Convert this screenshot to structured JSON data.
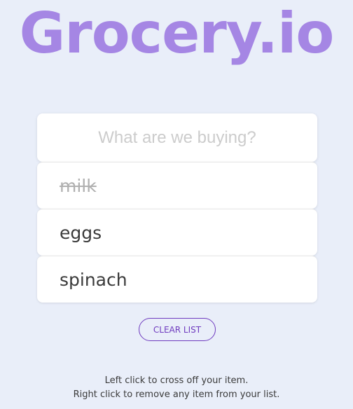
{
  "header": {
    "logo_text": "Grocery.io"
  },
  "input": {
    "placeholder": "What are we buying?",
    "value": ""
  },
  "items": [
    {
      "label": "milk",
      "crossed": true
    },
    {
      "label": "eggs",
      "crossed": false
    },
    {
      "label": "spinach",
      "crossed": false
    }
  ],
  "actions": {
    "clear_label": "CLEAR LIST"
  },
  "help": {
    "line1": "Left click to cross off your item.",
    "line2": "Right click to remove any item from your list."
  },
  "colors": {
    "background": "#e9eef9",
    "brand": "#a586e4",
    "accent": "#6f3bbf"
  }
}
